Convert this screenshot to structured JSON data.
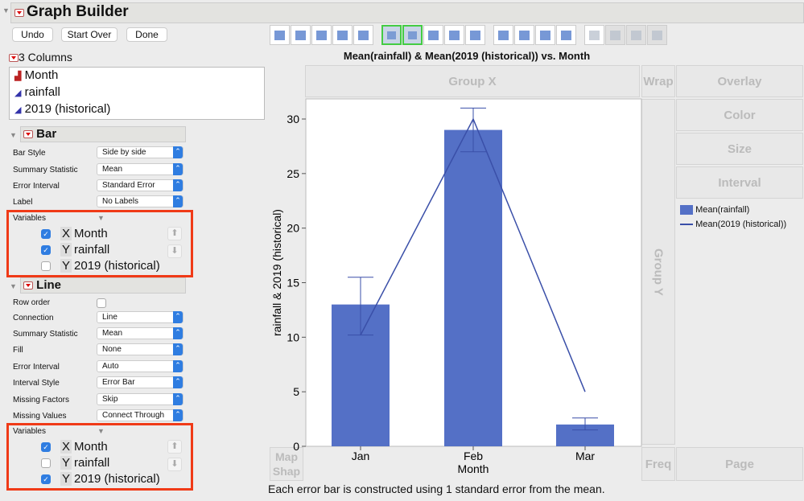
{
  "title": "Graph Builder",
  "buttons": {
    "undo": "Undo",
    "start_over": "Start Over",
    "done": "Done"
  },
  "columns": {
    "header": "3 Columns",
    "items": [
      "Month",
      "rainfall",
      "2019 (historical)"
    ]
  },
  "bar": {
    "title": "Bar",
    "settings": [
      {
        "label": "Bar Style",
        "value": "Side by side"
      },
      {
        "label": "Summary Statistic",
        "value": "Mean"
      },
      {
        "label": "Error Interval",
        "value": "Standard Error"
      },
      {
        "label": "Label",
        "value": "No Labels"
      }
    ],
    "variables_label": "Variables",
    "variables": [
      {
        "role": "X",
        "name": "Month",
        "checked": true
      },
      {
        "role": "Y",
        "name": "rainfall",
        "checked": true
      },
      {
        "role": "Y",
        "name": "2019 (historical)",
        "checked": false
      }
    ]
  },
  "line": {
    "title": "Line",
    "settings": [
      {
        "label": "Row order",
        "value": ""
      },
      {
        "label": "Connection",
        "value": "Line"
      },
      {
        "label": "Summary Statistic",
        "value": "Mean"
      },
      {
        "label": "Fill",
        "value": "None"
      },
      {
        "label": "Error Interval",
        "value": "Auto"
      },
      {
        "label": "Interval Style",
        "value": "Error Bar"
      },
      {
        "label": "Missing Factors",
        "value": "Skip"
      },
      {
        "label": "Missing Values",
        "value": "Connect Through"
      }
    ],
    "variables_label": "Variables",
    "variables": [
      {
        "role": "X",
        "name": "Month",
        "checked": true
      },
      {
        "role": "Y",
        "name": "rainfall",
        "checked": false
      },
      {
        "role": "Y",
        "name": "2019 (historical)",
        "checked": true
      }
    ]
  },
  "zones": {
    "group_x": "Group X",
    "wrap": "Wrap",
    "overlay": "Overlay",
    "color": "Color",
    "size": "Size",
    "interval": "Interval",
    "group_y": "Group Y",
    "map_shape": "Map Shap",
    "freq": "Freq",
    "page": "Page"
  },
  "footnote": "Each error bar is constructed using 1 standard error from the mean.",
  "colors": {
    "bar": "#5470c6",
    "line": "#3a4fa8"
  },
  "chart_data": {
    "type": "bar",
    "title": "Mean(rainfall) & Mean(2019 (historical)) vs. Month",
    "xlabel": "Month",
    "ylabel": "rainfall & 2019 (historical)",
    "categories": [
      "Jan",
      "Feb",
      "Mar"
    ],
    "ylim": [
      0,
      32
    ],
    "yticks": [
      0,
      5,
      10,
      15,
      20,
      25,
      30
    ],
    "series": [
      {
        "name": "Mean(rainfall)",
        "type": "bar",
        "values": [
          13,
          29,
          2
        ],
        "err_low": [
          10.2,
          27,
          1.5
        ],
        "err_high": [
          15.5,
          31,
          2.6
        ]
      },
      {
        "name": "Mean(2019 (historical))",
        "type": "line",
        "values": [
          10.2,
          30,
          5
        ]
      }
    ],
    "legend": "right"
  }
}
